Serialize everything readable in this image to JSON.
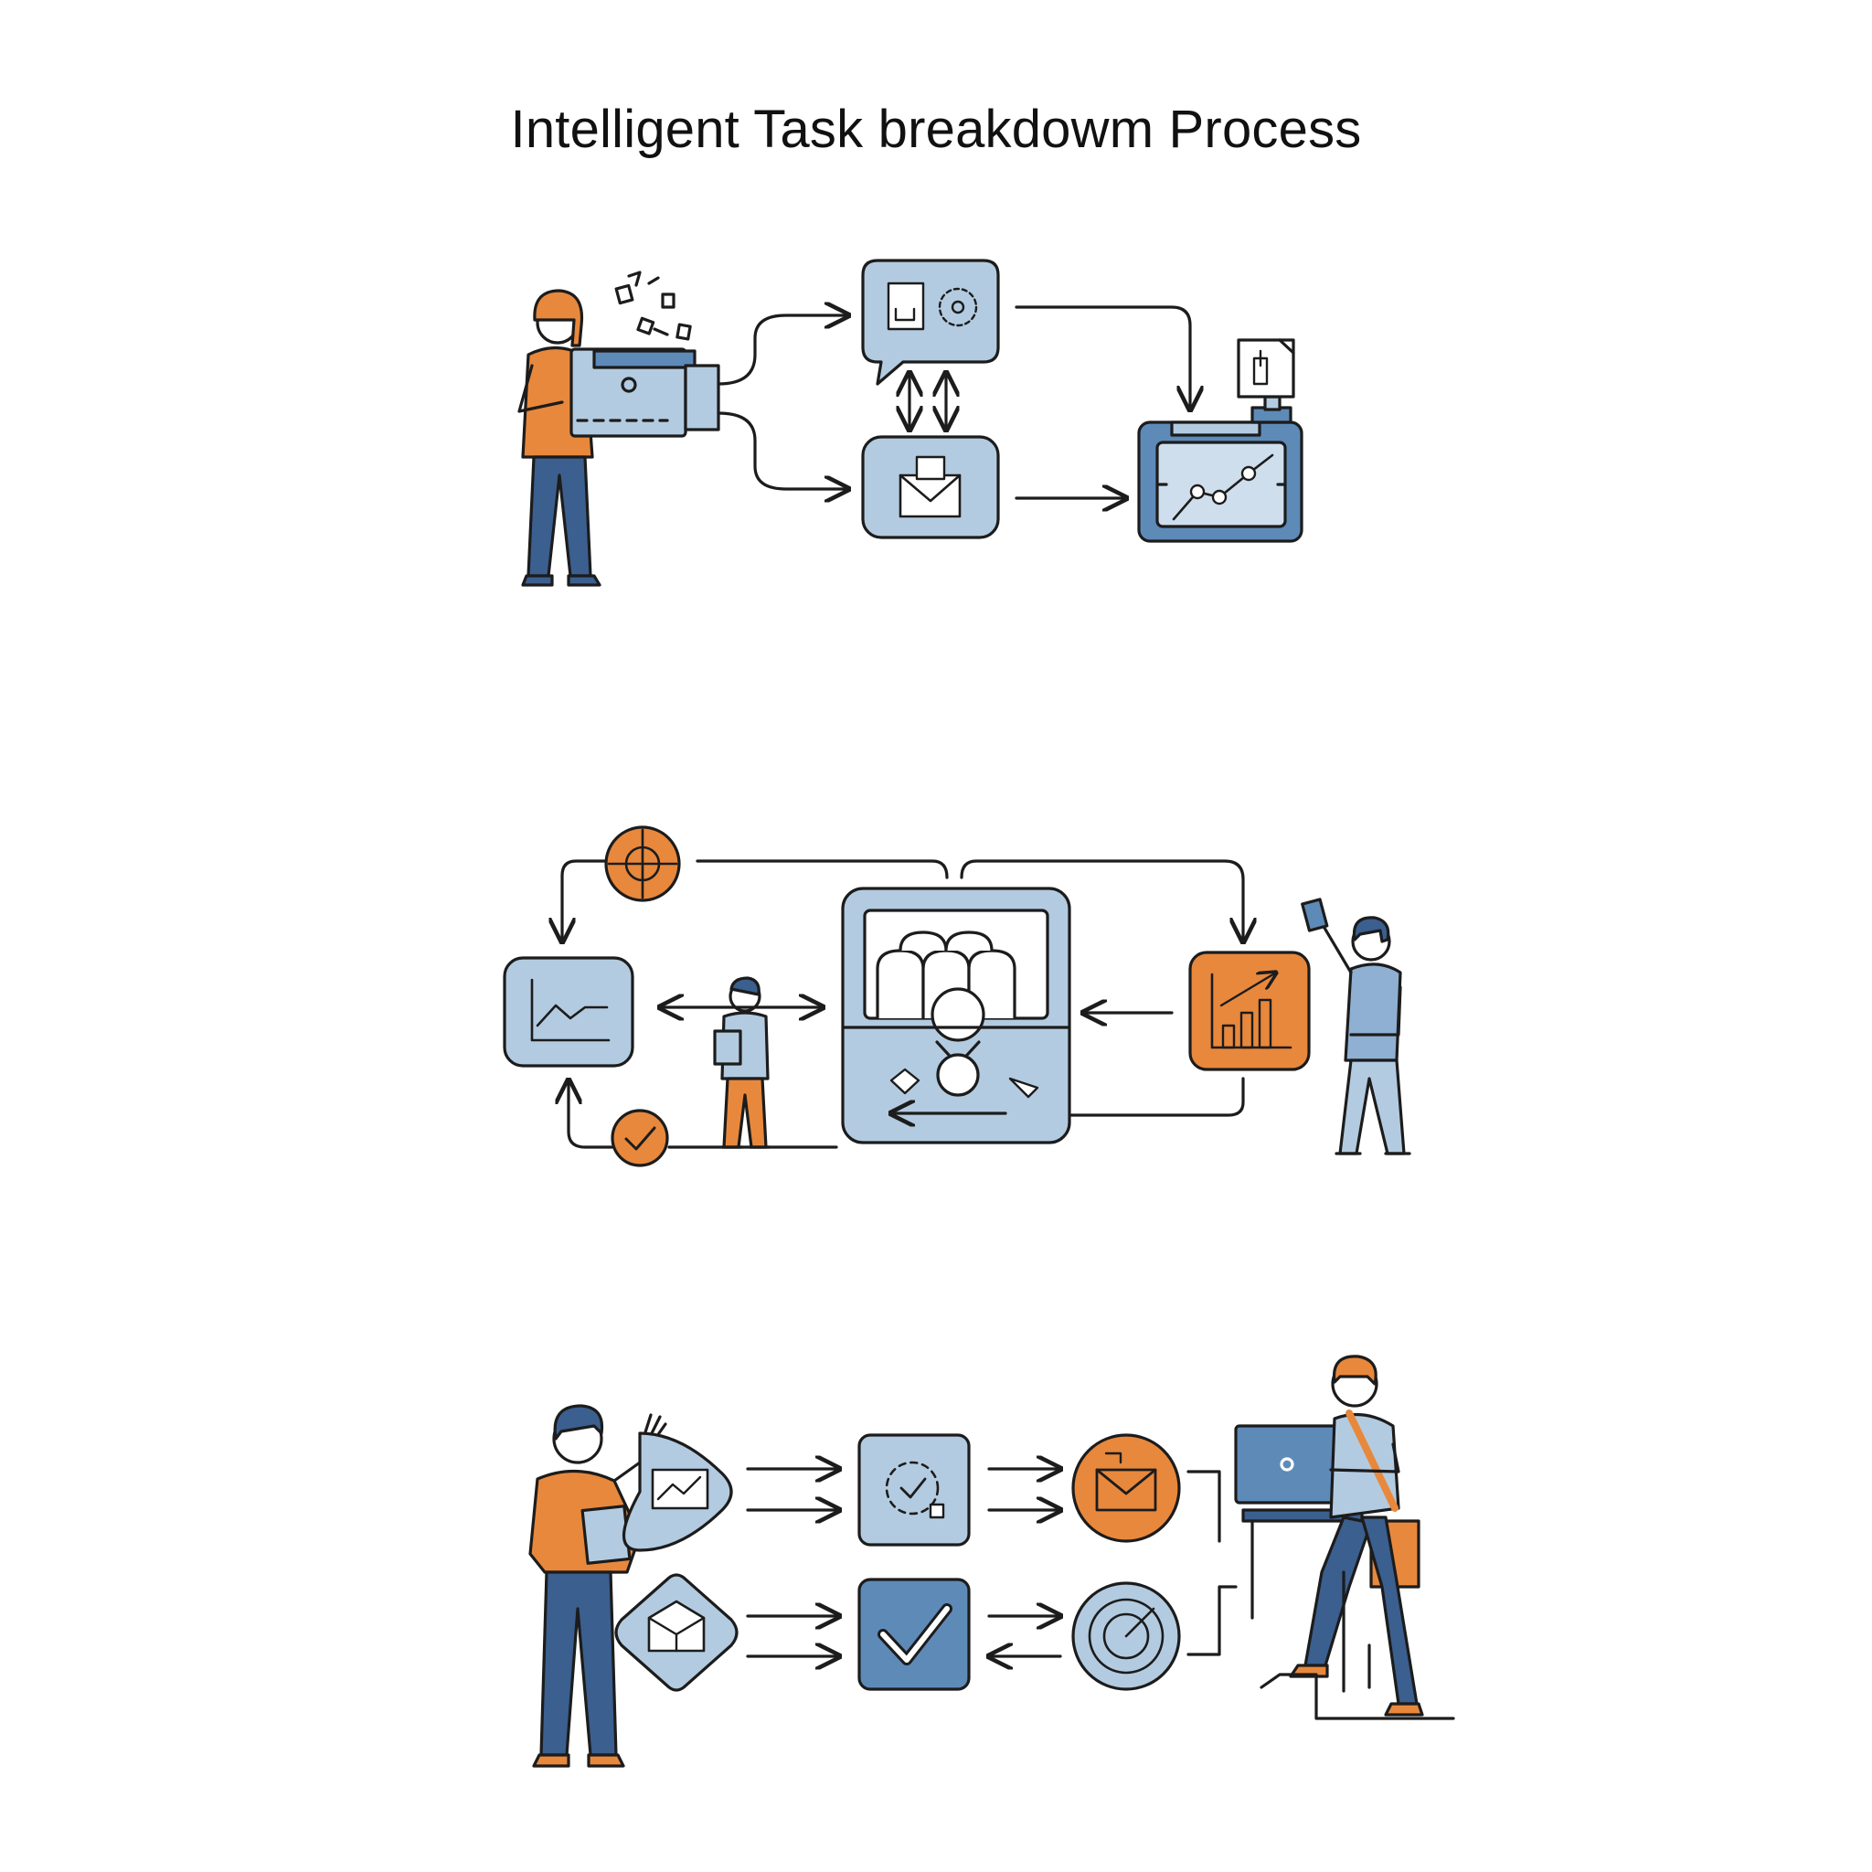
{
  "title": "Intelligent Task breakdowm Process",
  "colors": {
    "light_blue": "#b3cbe0",
    "mid_blue": "#5e8ab8",
    "dark_blue": "#3b5f8f",
    "orange": "#e8883c",
    "outline": "#1c1c1c",
    "skin": "#ffffff",
    "background": "#ffffff"
  },
  "icons": {
    "row1": [
      "document-target-icon",
      "envelope-icon",
      "line-chart-tablet-icon",
      "mobile-document-icon"
    ],
    "row2": [
      "orange-gear-icon",
      "trend-chart-icon",
      "sorting-machine-icon",
      "bar-chart-icon",
      "check-circle-icon"
    ],
    "row3": [
      "laptop-chart-icon",
      "box-icon",
      "dashed-check-icon",
      "checkmark-icon",
      "mail-icon",
      "radar-icon"
    ]
  }
}
